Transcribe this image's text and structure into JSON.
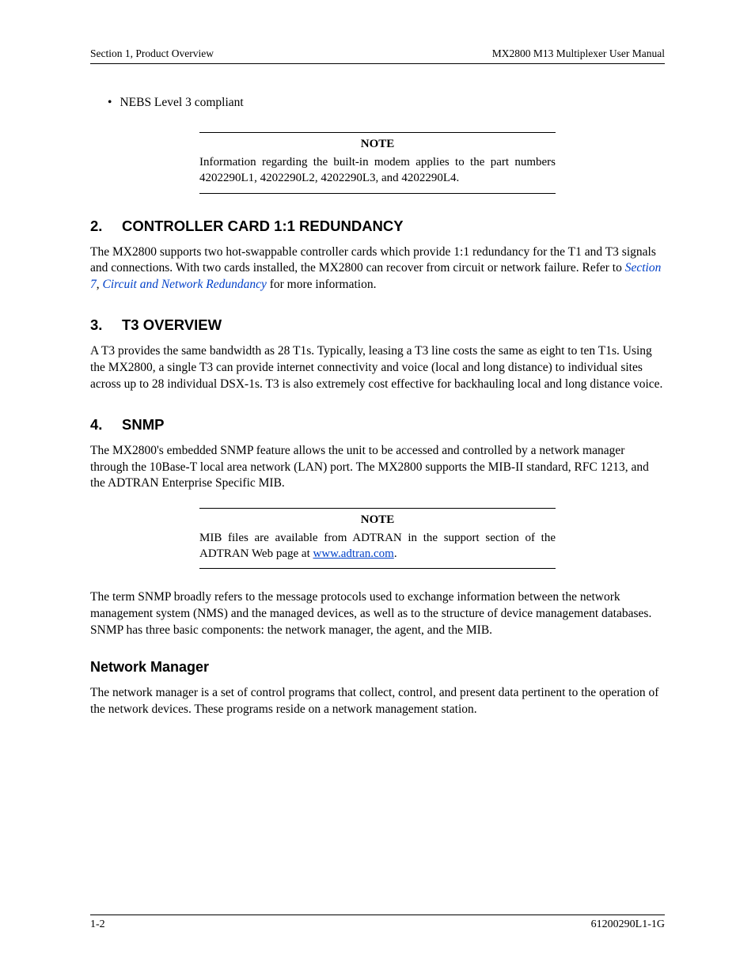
{
  "header": {
    "left": "Section 1, Product Overview",
    "right": "MX2800 M13 Multiplexer User Manual"
  },
  "bullet": "NEBS Level 3 compliant",
  "note1": {
    "label": "NOTE",
    "body": "Information regarding the built-in modem applies to the part numbers 4202290L1, 4202290L2, 4202290L3, and 4202290L4."
  },
  "sec2": {
    "num": "2.",
    "title": "CONTROLLER CARD 1:1 REDUNDANCY",
    "body_pre": "The MX2800 supports two hot-swappable controller cards which provide 1:1 redundancy for the T1 and T3 signals and connections. With two cards installed, the MX2800 can recover from circuit or network failure. Refer to ",
    "ref1": "Section 7",
    "sep": ", ",
    "ref2": "Circuit and Network Redundancy",
    "body_post": " for more information."
  },
  "sec3": {
    "num": "3.",
    "title": "T3 OVERVIEW",
    "body": "A T3 provides the same bandwidth as 28 T1s. Typically, leasing a T3 line costs the same as eight to ten T1s. Using the MX2800, a single T3 can provide internet connectivity and voice (local and long distance) to individual sites across up to 28 individual DSX-1s. T3 is also extremely cost effective for backhauling local and long distance voice."
  },
  "sec4": {
    "num": "4.",
    "title": "SNMP",
    "body1": "The MX2800's embedded SNMP feature allows the unit to be accessed and controlled by a network manager through the 10Base-T local area network (LAN) port. The MX2800 supports the MIB-II standard, RFC 1213, and the ADTRAN Enterprise Specific MIB."
  },
  "note2": {
    "label": "NOTE",
    "body_pre": "MIB files are available from ADTRAN in the support section of the ADTRAN Web page at ",
    "link": "www.adtran.com",
    "body_post": "."
  },
  "sec4_body2": "The term SNMP broadly refers to the message protocols used to exchange information between the network management system (NMS) and the managed devices, as well as to the structure of device management databases. SNMP has three basic components: the network manager, the agent, and the MIB.",
  "sub_nm": {
    "title": "Network Manager",
    "body": "The network manager is a set of control programs that collect, control, and present data pertinent to the operation of the network devices. These programs reside on a network management station."
  },
  "footer": {
    "left": "1-2",
    "right": "61200290L1-1G"
  }
}
